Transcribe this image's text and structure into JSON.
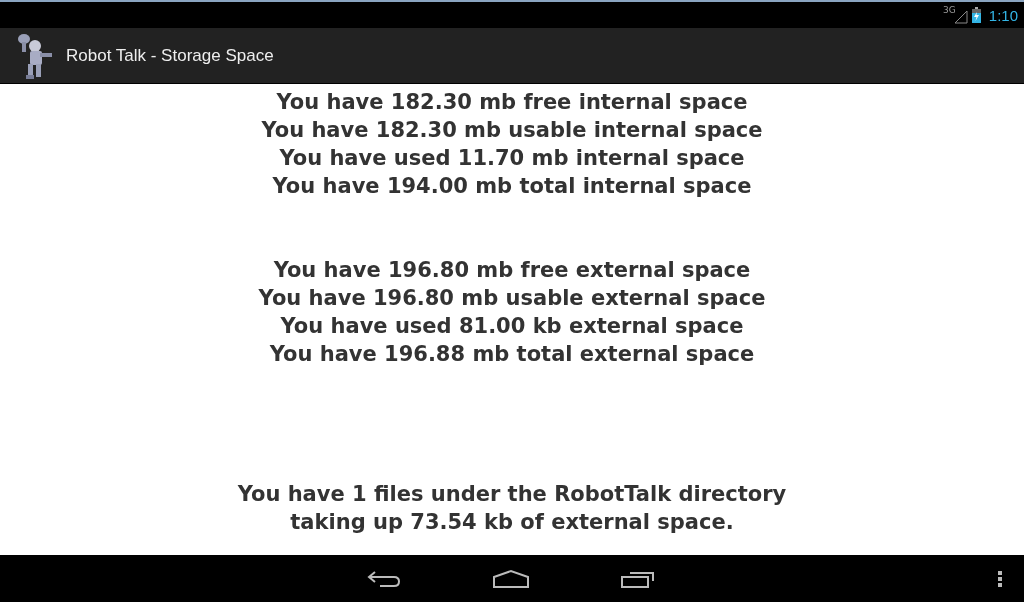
{
  "status_bar": {
    "network": "3G",
    "time": "1:10"
  },
  "action_bar": {
    "title": "Robot Talk - Storage Space"
  },
  "groups": [
    {
      "lines": [
        "You have 182.30 mb free internal space",
        "You have 182.30 mb usable internal space",
        "You have used 11.70 mb internal space",
        "You have 194.00 mb total internal space"
      ]
    },
    {
      "lines": [
        "You have 196.80 mb free external space",
        "You have 196.80 mb usable external space",
        "You have used 81.00 kb external space",
        "You have 196.88 mb total external space"
      ]
    },
    {
      "lines": [
        "You have 1 files under the RobotTalk directory",
        "taking up 73.54 kb of external space."
      ]
    }
  ]
}
